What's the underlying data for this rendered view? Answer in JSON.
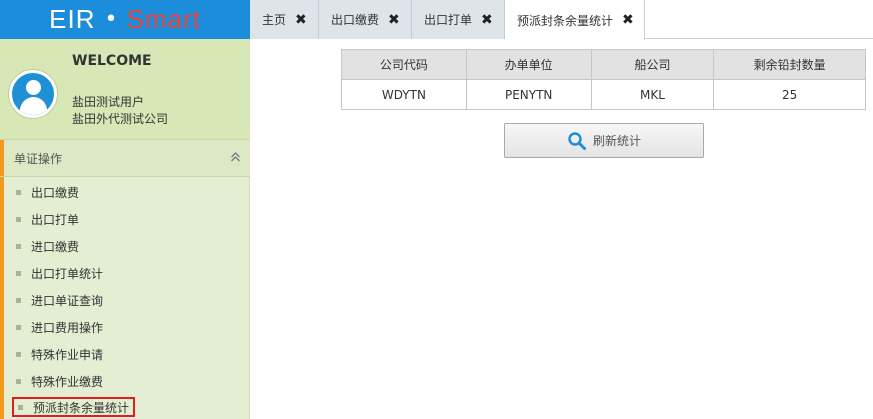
{
  "logo": {
    "part1": "EIR",
    "dot": "•",
    "part2": "Smart"
  },
  "tabs": [
    {
      "label": "主页",
      "close": "✖"
    },
    {
      "label": "出口缴费",
      "close": "✖"
    },
    {
      "label": "出口打单",
      "close": "✖"
    },
    {
      "label": "预派封条余量统计",
      "close": "✖"
    }
  ],
  "user": {
    "welcome": "WELCOME",
    "name": "盐田测试用户",
    "company": "盐田外代测试公司"
  },
  "section": {
    "title": "单证操作",
    "collapse_icon": "chevron-double-up-icon"
  },
  "menu": [
    {
      "label": "出口缴费"
    },
    {
      "label": "出口打单"
    },
    {
      "label": "进口缴费"
    },
    {
      "label": "出口打单统计"
    },
    {
      "label": "进口单证查询"
    },
    {
      "label": "进口费用操作"
    },
    {
      "label": "特殊作业申请"
    },
    {
      "label": "特殊作业缴费"
    },
    {
      "label": "预派封条余量统计"
    }
  ],
  "table": {
    "headers": [
      "公司代码",
      "办单单位",
      "船公司",
      "剩余铅封数量"
    ],
    "rows": [
      [
        "WDYTN",
        "PENYTN",
        "MKL",
        "25"
      ]
    ]
  },
  "refresh_button": {
    "label": "刷新统计",
    "icon": "search-icon"
  },
  "colors": {
    "brand": "#1c8ddb",
    "smart": "#e8453c",
    "accent": "#f29a1f",
    "sidebar": "#e4eed2"
  }
}
